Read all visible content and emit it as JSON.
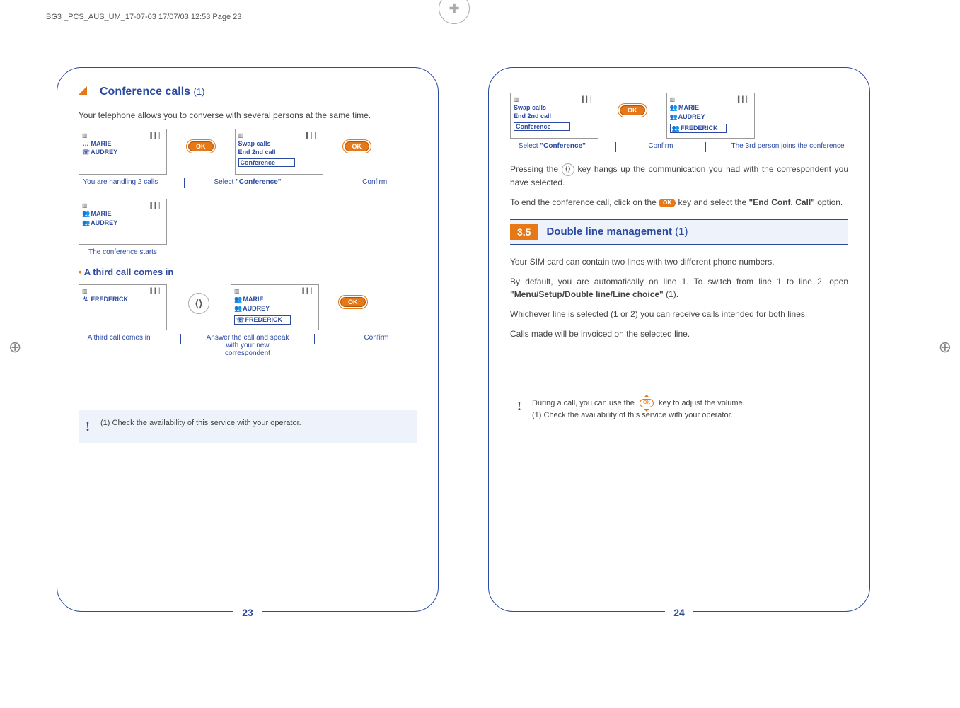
{
  "header": "BG3 _PCS_AUS_UM_17-07-03  17/07/03  12:53  Page 23",
  "left_page": {
    "num": "23",
    "title": "Conference calls",
    "title_suffix": "(1)",
    "intro": "Your telephone allows you to converse with several persons at the same time.",
    "screen1": {
      "line1_icon": "…",
      "line1": "MARIE",
      "line2_icon": "☏",
      "line2": "AUDREY"
    },
    "screen2": {
      "line1": "Swap calls",
      "line2": "End 2nd call",
      "line3": "Conference"
    },
    "captions1": {
      "c1": "You are handling 2 calls",
      "c2_a": "Select ",
      "c2_b": "\"Conference\"",
      "c3": "Confirm"
    },
    "screen3": {
      "icon": "👥",
      "line1": "MARIE",
      "line2": "AUDREY"
    },
    "caption3": "The conference starts",
    "subheading": "A third call comes in",
    "screen4": {
      "icon": "↯",
      "line1": "FREDERICK"
    },
    "screen5": {
      "icon1": "👥",
      "line1": "MARIE",
      "icon2": "👥",
      "line2": "AUDREY",
      "icon3": "☏",
      "line3": "FREDERICK"
    },
    "captions2": {
      "c1": "A third call comes in",
      "c2": "Answer the call and speak with your new correspondent",
      "c3": "Confirm"
    },
    "note_prefix": "(1) ",
    "note": "Check the availability of this service with your operator."
  },
  "right_page": {
    "num": "24",
    "screen1": {
      "line1": "Swap calls",
      "line2": "End 2nd call",
      "line3": "Conference"
    },
    "screen2": {
      "icon": "👥",
      "line1": "MARIE",
      "line2": "AUDREY",
      "line3": "FREDERICK"
    },
    "captions1": {
      "c1_a": "Select ",
      "c1_b": "\"Conference\"",
      "c2": "Confirm",
      "c3": "The 3rd person joins the conference"
    },
    "para1_a": "Pressing the ",
    "para1_b": " key hangs up the communication you had with the correspondent you have selected.",
    "para2_a": "To end the conference call, click on the ",
    "para2_b": " key and select the ",
    "para2_bold": "\"End Conf. Call\"",
    "para2_c": " option.",
    "sec_num": "3.5",
    "sec_title": "Double line management",
    "sec_suffix": "(1)",
    "para3": "Your SIM card can contain two lines with two different phone numbers.",
    "para4_a": "By default, you are automatically on line 1. To switch from line 1 to line 2, open ",
    "para4_bold": "\"Menu/Setup/Double line/Line choice\"",
    "para4_b": " (1).",
    "para5": "Whichever line is selected (1 or 2) you can receive calls intended for both lines.",
    "para6": "Calls made will be invoiced on the selected line.",
    "note1_a": "During a call, you can use the ",
    "note1_b": " key to adjust the volume.",
    "note2_prefix": "(1) ",
    "note2": "Check the availability of this service with your operator."
  },
  "ok": "OK",
  "sig": {
    "batt": "▥",
    "signal": "▍▎▏"
  }
}
